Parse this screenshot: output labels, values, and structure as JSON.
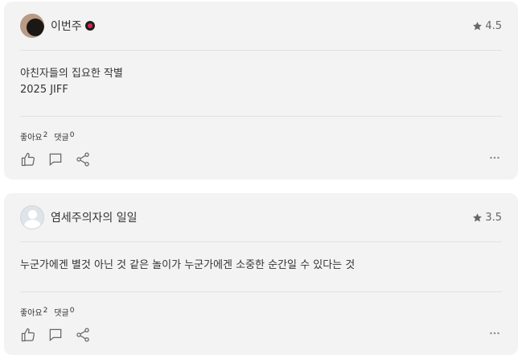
{
  "reviews": [
    {
      "author": "이번주",
      "avatar": "photo-avatar",
      "has_badge": true,
      "rating": "4.5",
      "text": "야친자들의 집요한 작별\n2025 JIFF",
      "likes_label": "좋아요",
      "likes_count": "2",
      "comments_label": "댓글",
      "comments_count": "0"
    },
    {
      "author": "염세주의자의 일일",
      "avatar": "default-avatar",
      "has_badge": false,
      "rating": "3.5",
      "text": "누군가에겐 별것 아닌 것 같은 놀이가 누군가에겐 소중한 순간일 수 있다는 것",
      "likes_label": "좋아요",
      "likes_count": "2",
      "comments_label": "댓글",
      "comments_count": "0"
    }
  ],
  "icons": {
    "rating": "star-icon",
    "like": "thumbs-up-icon",
    "comment": "comment-icon",
    "share": "share-icon",
    "more": "more-icon"
  },
  "colors": {
    "card_bg": "#f3f3f3",
    "badge_red": "#e0204a",
    "icon_gray": "#666666"
  }
}
